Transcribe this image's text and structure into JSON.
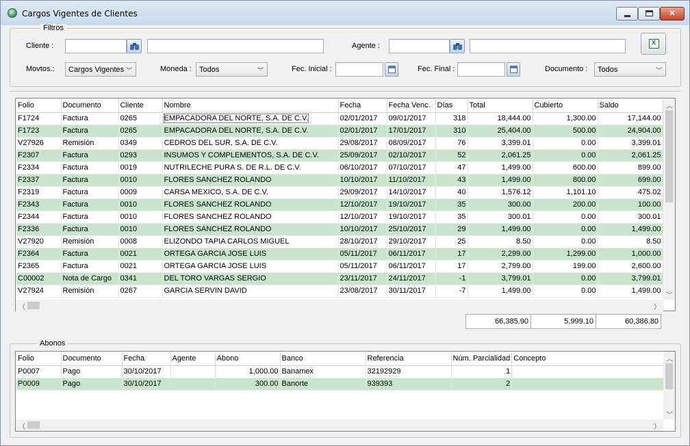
{
  "window": {
    "title": "Cargos Vigentes de Clientes",
    "min_glyph": "",
    "max_glyph": "",
    "close_glyph": "✕"
  },
  "filters": {
    "legend": "Filtros",
    "cliente_label": "Cliente :",
    "cliente_code": "",
    "cliente_name": "",
    "agente_label": "Agente :",
    "agente_code": "",
    "agente_name": "",
    "movtos_label": "Movtos.:",
    "movtos_value": "Cargos Vigentes",
    "moneda_label": "Moneda :",
    "moneda_value": "Todos",
    "fec_inicial_label": "Fec. Inicial :",
    "fec_inicial_value": "",
    "fec_final_label": "Fec. Final :",
    "fec_final_value": "",
    "documento_label": "Documento :",
    "documento_value": "Todos"
  },
  "cargos": {
    "columns": [
      "Folio",
      "Documento",
      "Cliente",
      "Nombre",
      "Fecha",
      "Fecha Venc.",
      "Días",
      "Total",
      "Cubierto",
      "Saldo"
    ],
    "rows": [
      [
        "F1724",
        "Factura",
        "0265",
        "EMPACADORA DEL NORTE, S.A. DE C.V.",
        "02/01/2017",
        "09/01/2017",
        "318",
        "18,444.00",
        "1,300.00",
        "17,144.00"
      ],
      [
        "F1723",
        "Factura",
        "0265",
        "EMPACADORA DEL NORTE, S.A. DE C.V.",
        "02/01/2017",
        "17/01/2017",
        "310",
        "25,404.00",
        "500.00",
        "24,904.00"
      ],
      [
        "V27926",
        "Remisión",
        "0349",
        "CEDROS DEL SUR, S.A. DE C.V.",
        "29/08/2017",
        "08/09/2017",
        "76",
        "3,399.01",
        "0.00",
        "3,399.01"
      ],
      [
        "F2307",
        "Factura",
        "0293",
        "INSUMOS Y COMPLEMENTOS, S.A. DE C.V.",
        "25/09/2017",
        "02/10/2017",
        "52",
        "2,061.25",
        "0.00",
        "2,061.25"
      ],
      [
        "F2334",
        "Factura",
        "0019",
        "NUTRILECHE PURA S. DE R.L. DE C.V.",
        "06/10/2017",
        "07/10/2017",
        "47",
        "1,499.00",
        "600.00",
        "899.00"
      ],
      [
        "F2337",
        "Factura",
        "0010",
        "FLORES SANCHEZ ROLANDO",
        "10/10/2017",
        "11/10/2017",
        "43",
        "1,499.00",
        "800.00",
        "699.00"
      ],
      [
        "F2319",
        "Factura",
        "0009",
        "CARSA MEXICO, S.A. DE C.V.",
        "29/09/2017",
        "14/10/2017",
        "40",
        "1,576.12",
        "1,101.10",
        "475.02"
      ],
      [
        "F2343",
        "Factura",
        "0010",
        "FLORES SANCHEZ ROLANDO",
        "12/10/2017",
        "19/10/2017",
        "35",
        "300.00",
        "200.00",
        "100.00"
      ],
      [
        "F2344",
        "Factura",
        "0010",
        "FLORES SANCHEZ ROLANDO",
        "12/10/2017",
        "19/10/2017",
        "35",
        "300.01",
        "0.00",
        "300.01"
      ],
      [
        "F2336",
        "Factura",
        "0010",
        "FLORES SANCHEZ ROLANDO",
        "10/10/2017",
        "25/10/2017",
        "29",
        "1,499.00",
        "0.00",
        "1,499.00"
      ],
      [
        "V27920",
        "Remisión",
        "0008",
        "ELIZONDO TAPIA CARLOS MIGUEL",
        "28/10/2017",
        "29/10/2017",
        "25",
        "8.50",
        "0.00",
        "8.50"
      ],
      [
        "F2364",
        "Factura",
        "0021",
        "ORTEGA GARCIA JOSE LUIS",
        "05/11/2017",
        "06/11/2017",
        "17",
        "2,299.00",
        "1,299.00",
        "1,000.00"
      ],
      [
        "F2365",
        "Factura",
        "0021",
        "ORTEGA GARCIA JOSE LUIS",
        "05/11/2017",
        "06/11/2017",
        "17",
        "2,799.00",
        "199.00",
        "2,600.00"
      ],
      [
        "C00002",
        "Nota de Cargo",
        "0341",
        "DEL TORO VARGAS SERGIO",
        "23/11/2017",
        "24/11/2017",
        "-1",
        "3,799.01",
        "0.00",
        "3,799.01"
      ],
      [
        "V27924",
        "Remisión",
        "0267",
        "GARCIA SERVIN DAVID",
        "23/08/2017",
        "30/11/2017",
        "-7",
        "1,499.00",
        "0.00",
        "1,499.00"
      ]
    ],
    "totals": {
      "total": "66,385.90",
      "cubierto": "5,999.10",
      "saldo": "60,386.80"
    }
  },
  "abonos": {
    "legend": "Abonos",
    "columns": [
      "Folio",
      "Documento",
      "Fecha",
      "Agente",
      "Abono",
      "Banco",
      "Referencia",
      "Núm. Parcialidad",
      "Concepto"
    ],
    "rows": [
      [
        "P0007",
        "Pago",
        "30/10/2017",
        "",
        "1,000.00",
        "Banamex",
        "32192929",
        "1",
        ""
      ],
      [
        "P0009",
        "Pago",
        "30/10/2017",
        "",
        "300.00",
        "Banorte",
        "939393",
        "2",
        ""
      ]
    ]
  },
  "icons": {
    "app": "app-icon",
    "search": "binoculars-icon",
    "calendar": "calendar-icon",
    "export": "excel-export-icon"
  },
  "colors": {
    "alt_row": "#c9e4cd",
    "title_bar": "#c9d9ec"
  }
}
